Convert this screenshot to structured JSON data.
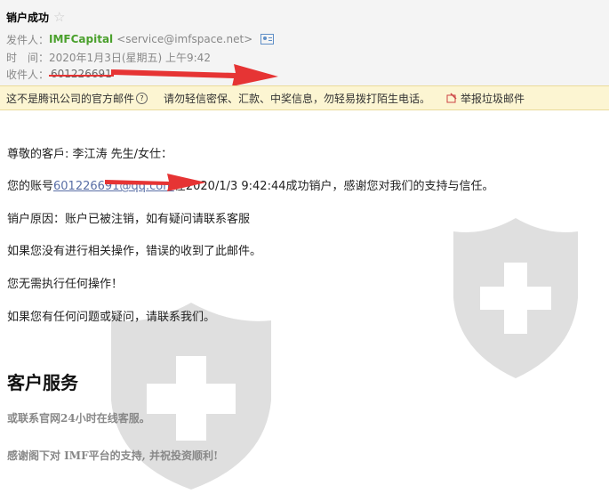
{
  "email": {
    "subject": "销户成功",
    "from_label": "发件人：",
    "sender_name": "IMFCapital",
    "sender_email": "<service@imfspace.net>",
    "time_label": "时　间：",
    "time": "2020年1月3日(星期五) 上午9:42",
    "to_label": "收件人：",
    "to_value": "601226691"
  },
  "warning": {
    "text": "这不是腾讯公司的官方邮件",
    "help": "?",
    "notice": "请勿轻信密保、汇款、中奖信息，勿轻易拨打陌生电话。",
    "report": "举报垃圾邮件"
  },
  "body": {
    "greeting": "尊敬的客戶: 李江涛 先生/女仕：",
    "line1_prefix": "您的账号",
    "account": "601226691@qq.com",
    "line1_suffix": "在2020/1/3 9:42:44成功销户，感谢您对我们的支持与信任。",
    "reason": "销户原因：账户已被注销，如有疑问请联系客服",
    "line3": "如果您没有进行相关操作，错误的收到了此邮件。",
    "line4": "您无需执行任何操作！",
    "line5": "如果您有任何问题或疑问，请联系我们。",
    "heading": "客户服务",
    "support": "或联系官网24小时在线客服。",
    "thanks": "感谢阁下对 IMF平台的支持, 并祝投资顺利!"
  },
  "colors": {
    "sender": "#4aa02c",
    "warning_bg": "#fcf5d2",
    "arrow": "#e63434",
    "link": "#5a6fa6"
  },
  "icons": [
    "star-icon",
    "contact-card-icon",
    "help-icon",
    "report-icon",
    "red-arrow",
    "shield-watermark"
  ]
}
